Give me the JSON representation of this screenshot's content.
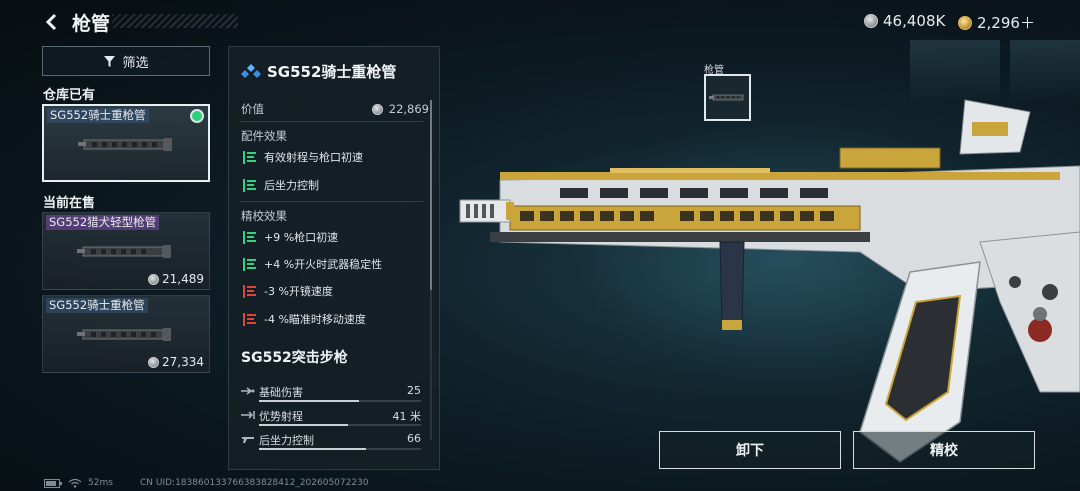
{
  "header": {
    "title": "枪管",
    "currency_silver": "46,408K",
    "currency_gold": "2,296＋"
  },
  "sidebar": {
    "filter_label": "筛选",
    "owned_section": "仓库已有",
    "owned_items": [
      {
        "name": "SG552骑士重枪管",
        "owned": true
      }
    ],
    "sale_section": "当前在售",
    "sale_items": [
      {
        "name": "SG552猎犬轻型枪管",
        "price": "21,489"
      },
      {
        "name": "SG552骑士重枪管",
        "price": "27,334"
      }
    ]
  },
  "detail": {
    "title": "SG552骑士重枪管",
    "value_label": "价值",
    "value": "22,869",
    "attachment_effects_label": "配件效果",
    "attachment_effects": [
      {
        "text": "有效射程与枪口初速",
        "type": "positive"
      },
      {
        "text": "后坐力控制",
        "type": "positive"
      }
    ],
    "tuning_label": "精校效果",
    "tuning_effects": [
      {
        "text": "+9 %枪口初速",
        "type": "positive"
      },
      {
        "text": "+4 %开火时武器稳定性",
        "type": "positive"
      },
      {
        "text": "-3 %开镜速度",
        "type": "negative"
      },
      {
        "text": "-4 %瞄准时移动速度",
        "type": "negative"
      }
    ],
    "gun_name": "SG552突击步枪",
    "stats": [
      {
        "name": "基础伤害",
        "value": "25",
        "level": 0.62
      },
      {
        "name": "优势射程",
        "value": "41 米",
        "level": 0.55
      },
      {
        "name": "后坐力控制",
        "value": "66",
        "level": 0.66
      }
    ]
  },
  "slot": {
    "label": "枪管"
  },
  "actions": {
    "unequip": "卸下",
    "tune": "精校"
  },
  "footer": {
    "ping": "52ms",
    "uid": "CN UID:18386013376638382841​2_202605072230"
  },
  "colors": {
    "positive": "#2fd483",
    "negative": "#e2433c",
    "selected_border": "#e9eef0"
  }
}
